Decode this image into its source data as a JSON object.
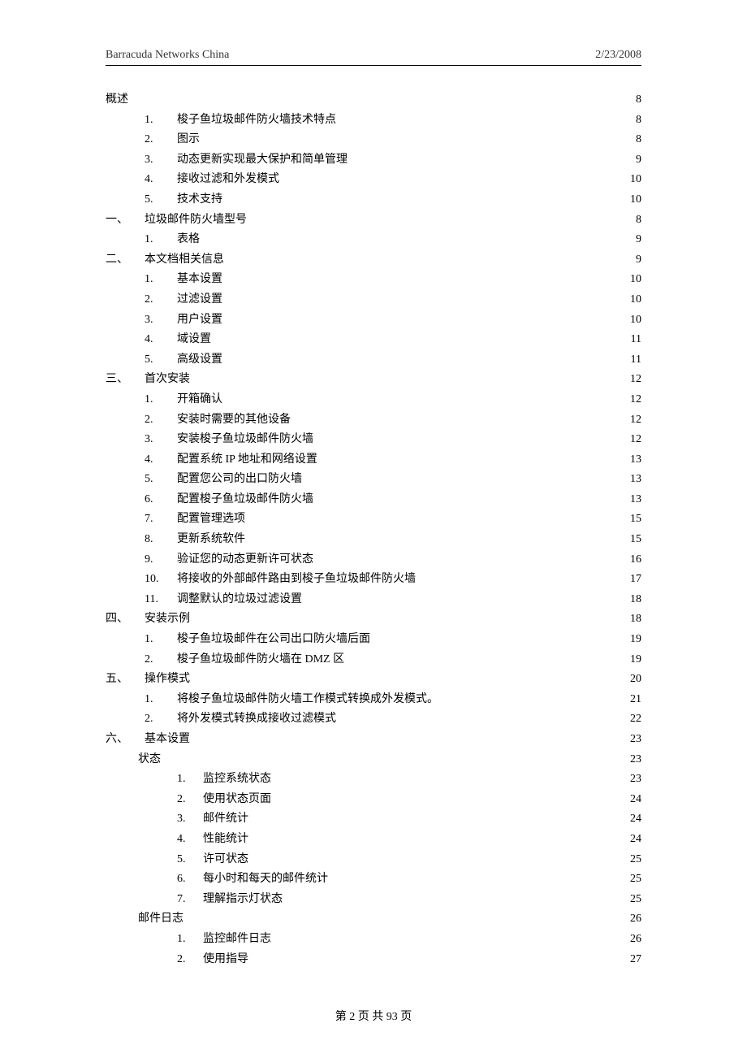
{
  "header": {
    "left": "Barracuda Networks China",
    "right": "2/23/2008"
  },
  "footer": "第 2 页 共 93 页",
  "toc": [
    {
      "a": "概述",
      "b": "",
      "bx": "",
      "t": "",
      "p": "8",
      "layout": "L0"
    },
    {
      "a": "",
      "b": "1.",
      "bx": "",
      "t": "梭子鱼垃圾邮件防火墙技术特点",
      "p": "8",
      "layout": "L1"
    },
    {
      "a": "",
      "b": "2.",
      "bx": "",
      "t": "图示",
      "p": "8",
      "layout": "L1"
    },
    {
      "a": "",
      "b": "3.",
      "bx": "",
      "t": "动态更新实现最大保护和简单管理",
      "p": "9",
      "layout": "L1"
    },
    {
      "a": "",
      "b": "4.",
      "bx": "",
      "t": "接收过滤和外发模式",
      "p": "10",
      "layout": "L1"
    },
    {
      "a": "",
      "b": "5.",
      "bx": "",
      "t": "技术支持",
      "p": "10",
      "layout": "L1"
    },
    {
      "a": "一、",
      "b": "",
      "bx": "",
      "t": "垃圾邮件防火墙型号",
      "p": "8",
      "layout": "L0T"
    },
    {
      "a": "",
      "b": "1.",
      "bx": "",
      "t": "表格",
      "p": "9",
      "layout": "L1"
    },
    {
      "a": "二、",
      "b": "",
      "bx": "",
      "t": "本文档相关信息",
      "p": "9",
      "layout": "L0T"
    },
    {
      "a": "",
      "b": "1.",
      "bx": "",
      "t": "基本设置",
      "p": "10",
      "layout": "L1"
    },
    {
      "a": "",
      "b": "2.",
      "bx": "",
      "t": "过滤设置",
      "p": "10",
      "layout": "L1"
    },
    {
      "a": "",
      "b": "3.",
      "bx": "",
      "t": "用户设置",
      "p": "10",
      "layout": "L1"
    },
    {
      "a": "",
      "b": "4.",
      "bx": "",
      "t": "域设置",
      "p": "11",
      "layout": "L1"
    },
    {
      "a": "",
      "b": "5.",
      "bx": "",
      "t": "高级设置",
      "p": "11",
      "layout": "L1"
    },
    {
      "a": "三、",
      "b": "",
      "bx": "",
      "t": "首次安装",
      "p": "12",
      "layout": "L0T"
    },
    {
      "a": "",
      "b": "1.",
      "bx": "",
      "t": "开箱确认",
      "p": "12",
      "layout": "L1"
    },
    {
      "a": "",
      "b": "2.",
      "bx": "",
      "t": "安装时需要的其他设备",
      "p": "12",
      "layout": "L1"
    },
    {
      "a": "",
      "b": "3.",
      "bx": "",
      "t": "安装梭子鱼垃圾邮件防火墙",
      "p": "12",
      "layout": "L1"
    },
    {
      "a": "",
      "b": "4.",
      "bx": "",
      "t": "配置系统 IP 地址和网络设置",
      "p": "13",
      "layout": "L1"
    },
    {
      "a": "",
      "b": "5.",
      "bx": "",
      "t": "配置您公司的出口防火墙",
      "p": "13",
      "layout": "L1"
    },
    {
      "a": "",
      "b": "6.",
      "bx": "",
      "t": "配置梭子鱼垃圾邮件防火墙",
      "p": "13",
      "layout": "L1"
    },
    {
      "a": "",
      "b": "7.",
      "bx": "",
      "t": "配置管理选项",
      "p": "15",
      "layout": "L1"
    },
    {
      "a": "",
      "b": "8.",
      "bx": "",
      "t": "更新系统软件",
      "p": "15",
      "layout": "L1"
    },
    {
      "a": "",
      "b": "9.",
      "bx": "",
      "t": "验证您的动态更新许可状态",
      "p": "16",
      "layout": "L1"
    },
    {
      "a": "",
      "b": "10.",
      "bx": "",
      "t": "将接收的外部邮件路由到梭子鱼垃圾邮件防火墙",
      "p": "17",
      "layout": "L1"
    },
    {
      "a": "",
      "b": "11.",
      "bx": "",
      "t": "调整默认的垃圾过滤设置",
      "p": "18",
      "layout": "L1"
    },
    {
      "a": "四、",
      "b": "",
      "bx": "",
      "t": "安装示例",
      "p": "18",
      "layout": "L0T"
    },
    {
      "a": "",
      "b": "1.",
      "bx": "",
      "t": "梭子鱼垃圾邮件在公司出口防火墙后面",
      "p": "19",
      "layout": "L1"
    },
    {
      "a": "",
      "b": "2.",
      "bx": "",
      "t": "梭子鱼垃圾邮件防火墙在 DMZ 区",
      "p": "19",
      "layout": "L1"
    },
    {
      "a": "五、",
      "b": "",
      "bx": "",
      "t": "操作模式",
      "p": "20",
      "layout": "L0T"
    },
    {
      "a": "",
      "b": "1.",
      "bx": "",
      "t": "将梭子鱼垃圾邮件防火墙工作模式转换成外发模式。",
      "p": "21",
      "layout": "L1"
    },
    {
      "a": "",
      "b": "2.",
      "bx": "",
      "t": "将外发模式转换成接收过滤模式",
      "p": "22",
      "layout": "L1"
    },
    {
      "a": "六、",
      "b": "",
      "bx": "",
      "t": "基本设置",
      "p": "23",
      "layout": "L0T"
    },
    {
      "a": "",
      "b": "状态",
      "bx": "",
      "t": "",
      "p": "23",
      "layout": "SUB"
    },
    {
      "a": "",
      "b": "",
      "bx": "1.",
      "t": "监控系统状态",
      "p": "23",
      "layout": "L2"
    },
    {
      "a": "",
      "b": "",
      "bx": "2.",
      "t": "使用状态页面",
      "p": "24",
      "layout": "L2"
    },
    {
      "a": "",
      "b": "",
      "bx": "3.",
      "t": "邮件统计",
      "p": "24",
      "layout": "L2"
    },
    {
      "a": "",
      "b": "",
      "bx": "4.",
      "t": "性能统计",
      "p": "24",
      "layout": "L2"
    },
    {
      "a": "",
      "b": "",
      "bx": "5.",
      "t": "许可状态",
      "p": "25",
      "layout": "L2"
    },
    {
      "a": "",
      "b": "",
      "bx": "6.",
      "t": "每小时和每天的邮件统计",
      "p": "25",
      "layout": "L2"
    },
    {
      "a": "",
      "b": "",
      "bx": "7.",
      "t": "理解指示灯状态",
      "p": "25",
      "layout": "L2"
    },
    {
      "a": "",
      "b": "邮件日志",
      "bx": "",
      "t": "",
      "p": "26",
      "layout": "SUB"
    },
    {
      "a": "",
      "b": "",
      "bx": "1.",
      "t": "监控邮件日志",
      "p": "26",
      "layout": "L2"
    },
    {
      "a": "",
      "b": "",
      "bx": "2.",
      "t": "使用指导",
      "p": "27",
      "layout": "L2"
    }
  ]
}
